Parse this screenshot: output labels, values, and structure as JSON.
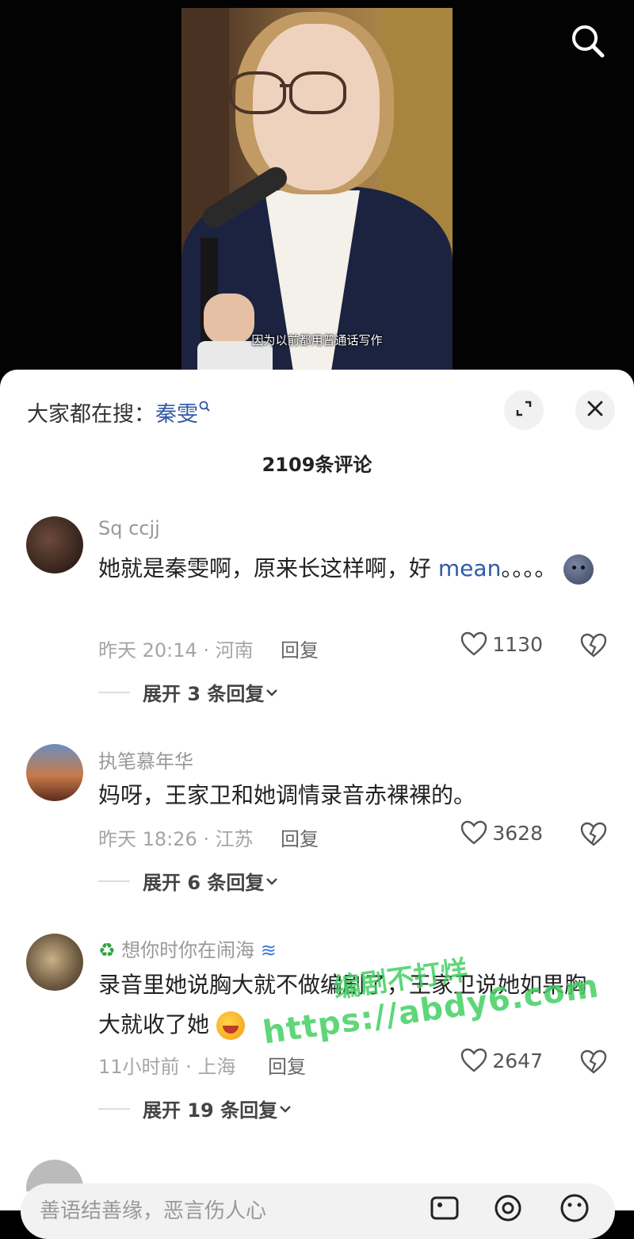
{
  "video": {
    "subtitle": "因为以前都用普通话写作",
    "search_icon": "search-icon"
  },
  "sheet": {
    "hot_search": {
      "label": "大家都在搜：",
      "keyword": "秦雯"
    },
    "comment_count": "2109条评论",
    "expand_icon": "expand-icon",
    "close_icon": "close-icon"
  },
  "comments": [
    {
      "username": "Sq ccjj",
      "text_plain": "她就是秦雯啊，原来长这样啊，好 ",
      "text_link": "mean",
      "text_tail": "。。。。",
      "time": "昨天 20:14 · 河南",
      "reply": "回复",
      "likes": "1130",
      "expand": "展开 3 条回复"
    },
    {
      "username": "执笔慕年华",
      "text": "妈呀，王家卫和她调情录音赤裸裸的。",
      "time": "昨天 18:26 · 江苏",
      "reply": "回复",
      "likes": "3628",
      "expand": "展开 6 条回复"
    },
    {
      "username": "想你时你在闹海",
      "text": "录音里她说胸大就不做编剧了，王家卫说她如果胸大就收了她",
      "time": "11小时前 · 上海",
      "reply": "回复",
      "likes": "2647",
      "expand": "展开 19 条回复"
    }
  ],
  "watermark": {
    "line1": "编剧不打烊",
    "line2": "https://abdy6.com"
  },
  "input": {
    "placeholder": "善语结善缘，恶言伤人心"
  },
  "colors": {
    "link": "#2f5aa6",
    "watermark": "#44d063"
  }
}
